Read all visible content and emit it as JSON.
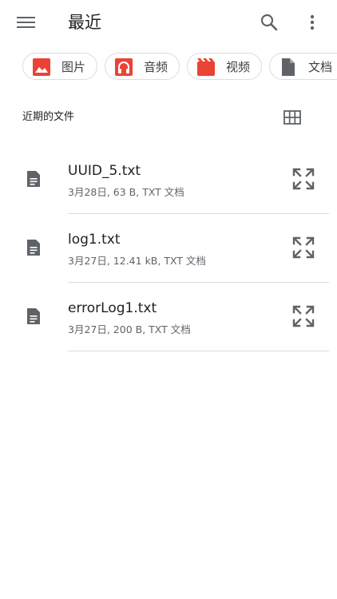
{
  "header": {
    "title": "最近",
    "menu_icon": "menu-icon",
    "search_icon": "search-icon",
    "more_icon": "more-vert-icon"
  },
  "chips": [
    {
      "label": "图片",
      "icon": "image-icon",
      "color": "#ea4335"
    },
    {
      "label": "音频",
      "icon": "headphones-icon",
      "color": "#ea4335"
    },
    {
      "label": "视频",
      "icon": "movie-icon",
      "color": "#ea4335"
    },
    {
      "label": "文档",
      "icon": "document-icon",
      "color": "#5f6368"
    }
  ],
  "section": {
    "title": "近期的文件",
    "view_toggle_icon": "grid-view-icon"
  },
  "files": [
    {
      "name": "UUID_5.txt",
      "meta": "3月28日, 63 B, TXT 文档",
      "icon": "text-file-icon",
      "action_icon": "fullscreen-icon"
    },
    {
      "name": "log1.txt",
      "meta": "3月27日, 12.41 kB, TXT 文档",
      "icon": "text-file-icon",
      "action_icon": "fullscreen-icon"
    },
    {
      "name": "errorLog1.txt",
      "meta": "3月27日, 200 B, TXT 文档",
      "icon": "text-file-icon",
      "action_icon": "fullscreen-icon"
    }
  ],
  "colors": {
    "accent_red": "#ea4335",
    "icon_gray": "#5f6368",
    "divider": "#dadce0",
    "text_primary": "#202124",
    "text_secondary": "#5f6368"
  }
}
